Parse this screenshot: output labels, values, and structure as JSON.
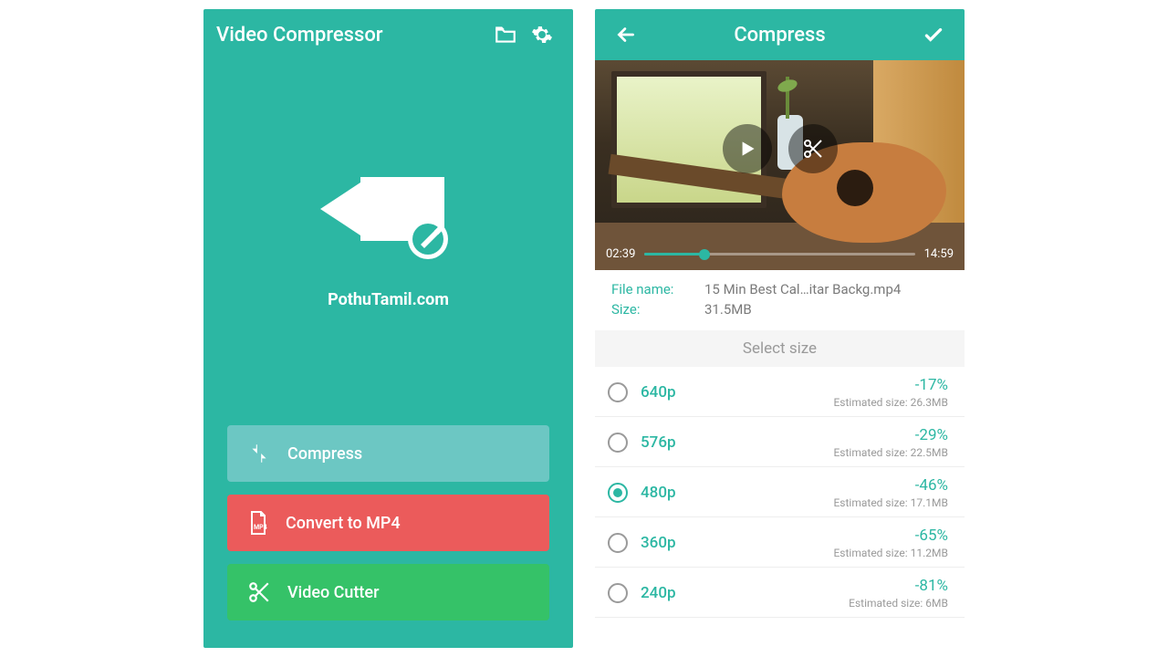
{
  "home": {
    "title": "Video Compressor",
    "tagline": "PothuTamil.com",
    "buttons": {
      "compress": "Compress",
      "convert": "Convert to MP4",
      "cut": "Video Cutter"
    }
  },
  "detail": {
    "title": "Compress",
    "video": {
      "elapsed": "02:39",
      "total": "14:59"
    },
    "meta": {
      "filename_label": "File name:",
      "filename_value": "15 Min Best Cal…itar  Backg.mp4",
      "size_label": "Size:",
      "size_value": "31.5MB"
    },
    "size_header": "Select size",
    "est_prefix": "Estimated size: ",
    "sizes": [
      {
        "name": "640p",
        "pct": "-17%",
        "est": "26.3MB",
        "selected": false
      },
      {
        "name": "576p",
        "pct": "-29%",
        "est": "22.5MB",
        "selected": false
      },
      {
        "name": "480p",
        "pct": "-46%",
        "est": "17.1MB",
        "selected": true
      },
      {
        "name": "360p",
        "pct": "-65%",
        "est": "11.2MB",
        "selected": false
      },
      {
        "name": "240p",
        "pct": "-81%",
        "est": "6MB",
        "selected": false
      }
    ]
  }
}
